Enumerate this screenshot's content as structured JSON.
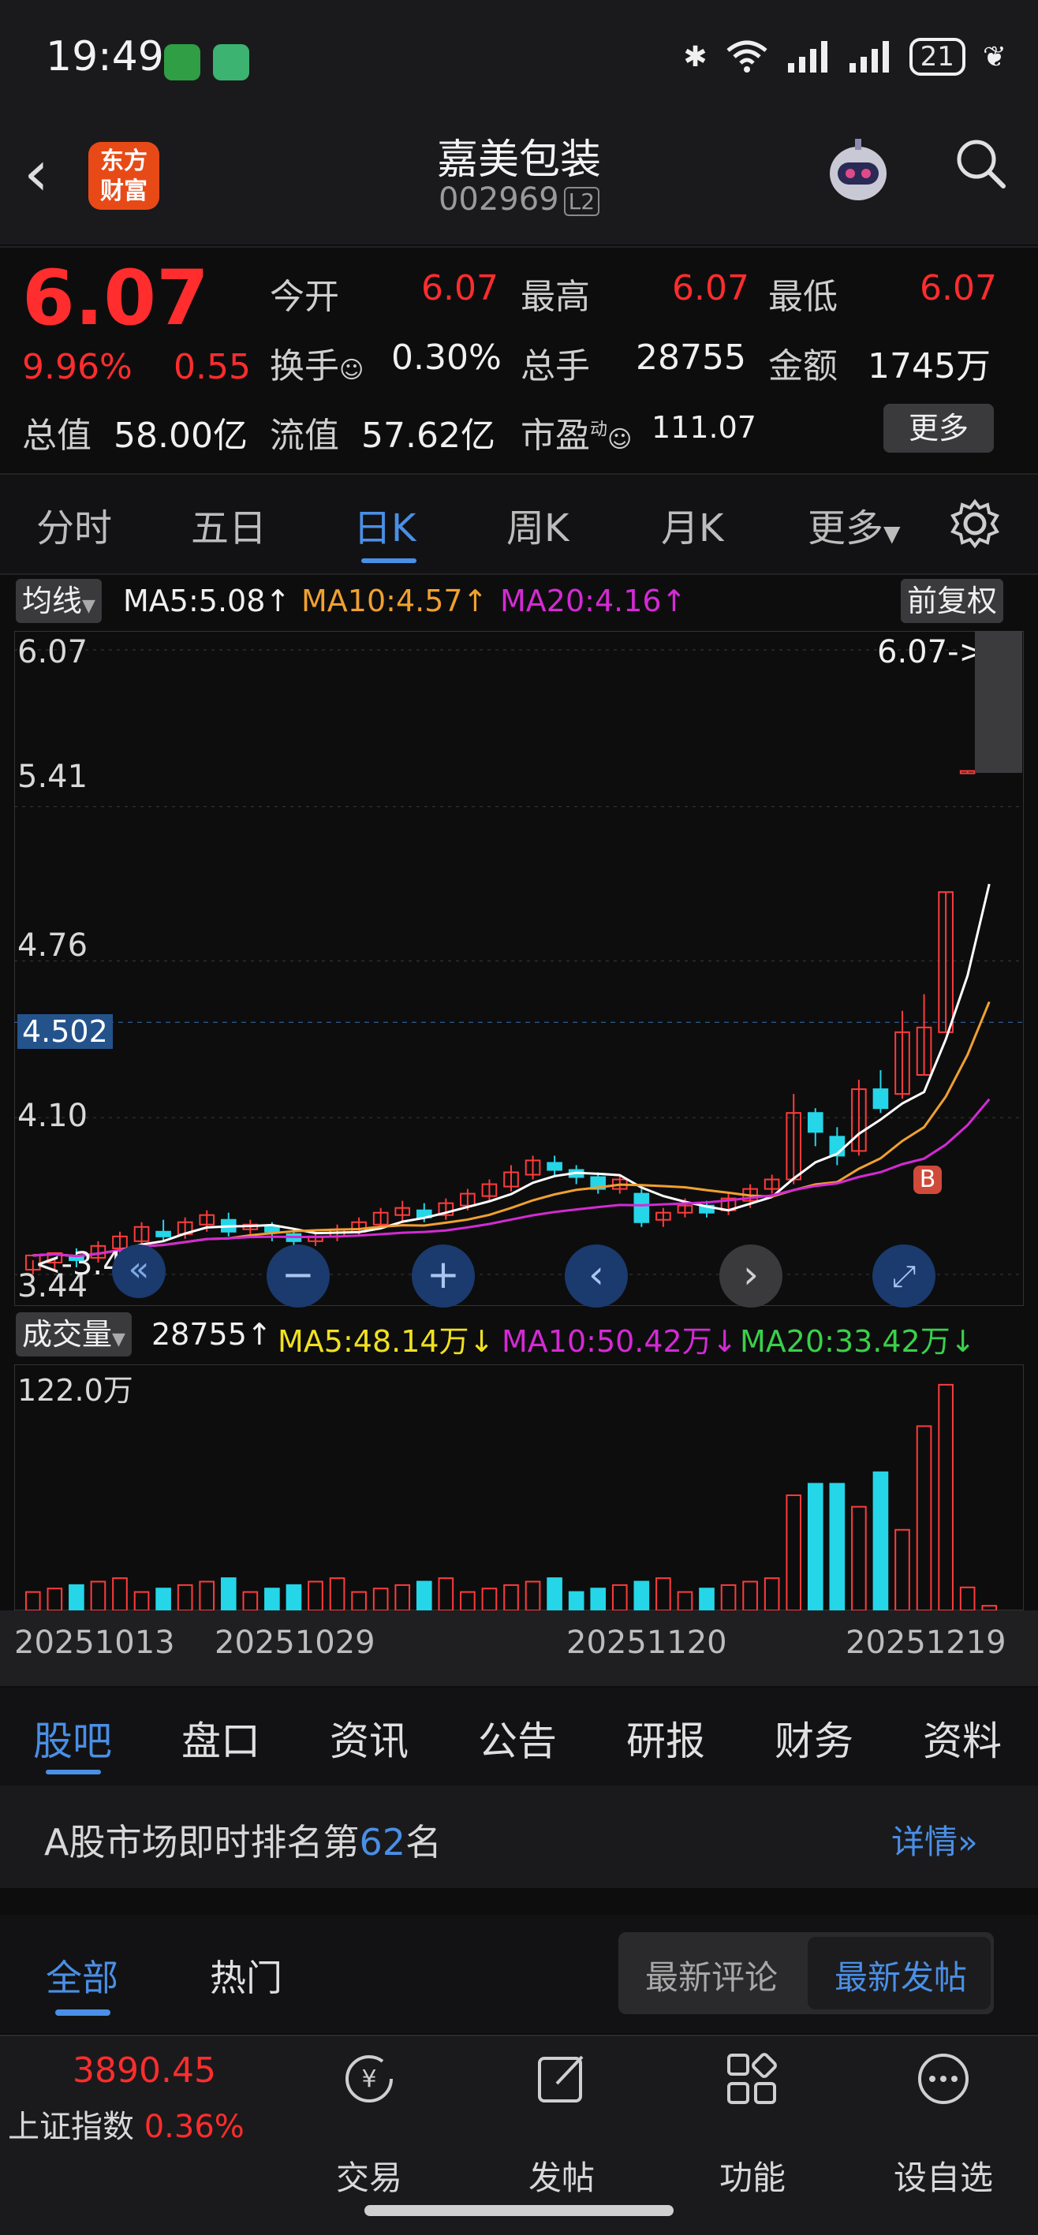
{
  "status_bar": {
    "time": "19:49",
    "battery": "21"
  },
  "header": {
    "logo_line1": "东方",
    "logo_line2": "财富",
    "title": "嘉美包装",
    "code": "002969",
    "badge": "L2"
  },
  "quote": {
    "price": "6.07",
    "pct": "9.96%",
    "change": "0.55",
    "open_label": "今开",
    "open": "6.07",
    "high_label": "最高",
    "high": "6.07",
    "low_label": "最低",
    "low": "6.07",
    "turnover_label": "换手",
    "turnover": "0.30%",
    "volume_label": "总手",
    "volume": "28755",
    "amount_label": "金额",
    "amount": "1745万",
    "mcap_label": "总值",
    "mcap": "58.00亿",
    "float_label": "流值",
    "float": "57.62亿",
    "pe_label": "市盈",
    "pe_sup": "动",
    "pe": "111.07",
    "more": "更多"
  },
  "period_tabs": [
    "分时",
    "五日",
    "日K",
    "周K",
    "月K",
    "更多"
  ],
  "active_period": "日K",
  "ma_line": {
    "tag": "均线",
    "ma5": "MA5:5.08",
    "ma10": "MA10:4.57",
    "ma20": "MA20:4.16",
    "adjust": "前复权"
  },
  "price_axis": {
    "top": "6.07",
    "l1": "5.41",
    "l2": "4.76",
    "current": "4.502",
    "l3": "4.10",
    "bottom": "3.44",
    "max_label": "6.07->",
    "min_label": "<-3.44"
  },
  "volume_line": {
    "tag": "成交量",
    "vol": "28755",
    "ma5": "MA5:48.14万",
    "ma10": "MA10:50.42万",
    "ma20": "MA20:33.42万",
    "max": "122.0万"
  },
  "dates": [
    "20251013",
    "20251029",
    "20251120",
    "20251219"
  ],
  "bottom_tabs": [
    "股吧",
    "盘口",
    "资讯",
    "公告",
    "研报",
    "财务",
    "资料"
  ],
  "rank": {
    "prefix": "A股市场即时排名第",
    "number": "62",
    "suffix": "名",
    "detail": "详情"
  },
  "sub_tabs": {
    "all": "全部",
    "hot": "热门",
    "latest_comment": "最新评论",
    "latest_post": "最新发帖"
  },
  "footer": {
    "index_value": "3890.45",
    "index_name": "上证指数",
    "index_pct": "0.36%",
    "trade": "交易",
    "post": "发帖",
    "func": "功能",
    "watch": "设自选"
  },
  "chart_data": {
    "type": "candlestick",
    "ylim": [
      3.44,
      6.07
    ],
    "candles": [
      [
        3.46,
        3.52,
        3.44,
        3.5,
        "up"
      ],
      [
        3.49,
        3.53,
        3.46,
        3.51,
        "up"
      ],
      [
        3.52,
        3.5,
        3.47,
        3.55,
        "down"
      ],
      [
        3.51,
        3.56,
        3.49,
        3.58,
        "up"
      ],
      [
        3.55,
        3.6,
        3.53,
        3.62,
        "up"
      ],
      [
        3.58,
        3.64,
        3.55,
        3.66,
        "up"
      ],
      [
        3.62,
        3.6,
        3.58,
        3.67,
        "down"
      ],
      [
        3.61,
        3.66,
        3.59,
        3.68,
        "up"
      ],
      [
        3.65,
        3.69,
        3.62,
        3.71,
        "up"
      ],
      [
        3.67,
        3.62,
        3.6,
        3.7,
        "down"
      ],
      [
        3.63,
        3.65,
        3.6,
        3.67,
        "up"
      ],
      [
        3.64,
        3.62,
        3.58,
        3.66,
        "down"
      ],
      [
        3.61,
        3.58,
        3.55,
        3.63,
        "down"
      ],
      [
        3.58,
        3.6,
        3.56,
        3.62,
        "up"
      ],
      [
        3.6,
        3.63,
        3.58,
        3.65,
        "up"
      ],
      [
        3.62,
        3.66,
        3.6,
        3.68,
        "up"
      ],
      [
        3.65,
        3.7,
        3.63,
        3.72,
        "up"
      ],
      [
        3.69,
        3.72,
        3.66,
        3.75,
        "up"
      ],
      [
        3.71,
        3.68,
        3.66,
        3.74,
        "down"
      ],
      [
        3.69,
        3.74,
        3.67,
        3.76,
        "up"
      ],
      [
        3.73,
        3.78,
        3.71,
        3.8,
        "up"
      ],
      [
        3.77,
        3.82,
        3.75,
        3.84,
        "up"
      ],
      [
        3.81,
        3.87,
        3.79,
        3.9,
        "up"
      ],
      [
        3.86,
        3.92,
        3.84,
        3.94,
        "up"
      ],
      [
        3.91,
        3.88,
        3.85,
        3.94,
        "down"
      ],
      [
        3.88,
        3.85,
        3.82,
        3.9,
        "down"
      ],
      [
        3.85,
        3.8,
        3.78,
        3.87,
        "down"
      ],
      [
        3.8,
        3.84,
        3.78,
        3.86,
        "up"
      ],
      [
        3.78,
        3.66,
        3.64,
        3.8,
        "down"
      ],
      [
        3.67,
        3.7,
        3.64,
        3.72,
        "up"
      ],
      [
        3.7,
        3.73,
        3.68,
        3.76,
        "up"
      ],
      [
        3.73,
        3.7,
        3.68,
        3.75,
        "down"
      ],
      [
        3.71,
        3.76,
        3.69,
        3.78,
        "up"
      ],
      [
        3.75,
        3.8,
        3.72,
        3.82,
        "up"
      ],
      [
        3.8,
        3.84,
        3.78,
        3.86,
        "up"
      ],
      [
        3.84,
        4.12,
        3.82,
        4.2,
        "up"
      ],
      [
        4.12,
        4.04,
        3.98,
        4.14,
        "down"
      ],
      [
        4.02,
        3.94,
        3.9,
        4.06,
        "down"
      ],
      [
        3.96,
        4.22,
        3.94,
        4.26,
        "up"
      ],
      [
        4.22,
        4.14,
        4.12,
        4.3,
        "down"
      ],
      [
        4.2,
        4.46,
        4.18,
        4.55,
        "up"
      ],
      [
        4.48,
        4.28,
        4.28,
        4.62,
        "up"
      ],
      [
        4.46,
        5.05,
        4.46,
        5.05,
        "up"
      ],
      [
        5.55,
        5.56,
        5.55,
        5.56,
        "up"
      ],
      [
        6.07,
        6.07,
        6.07,
        6.07,
        "up"
      ]
    ]
  }
}
